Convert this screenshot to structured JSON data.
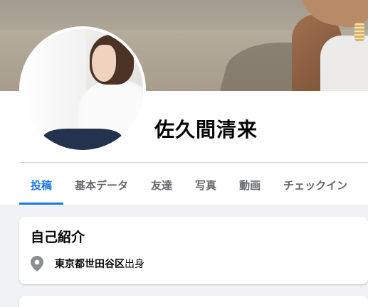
{
  "profile": {
    "name": "佐久間清来"
  },
  "tabs": [
    {
      "label": "投稿",
      "active": true
    },
    {
      "label": "基本データ",
      "active": false
    },
    {
      "label": "友達",
      "active": false
    },
    {
      "label": "写真",
      "active": false
    },
    {
      "label": "動画",
      "active": false
    },
    {
      "label": "チェックイン",
      "active": false
    }
  ],
  "intro": {
    "title": "自己紹介",
    "hometown_place": "東京都世田谷区",
    "hometown_suffix": "出身",
    "icon": "location-pin-icon"
  },
  "colors": {
    "accent": "#1877f2",
    "background": "#f0f2f5",
    "tab_inactive": "#65676b"
  }
}
